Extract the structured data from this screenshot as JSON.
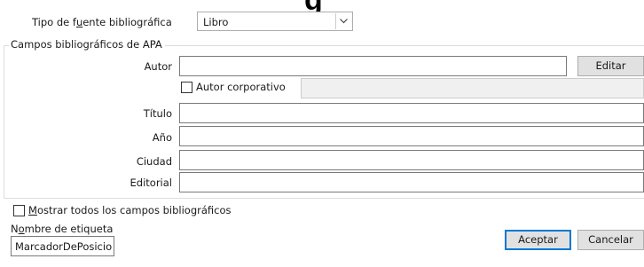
{
  "background_title": {
    "fragment": "g"
  },
  "source_type": {
    "label_pre": "Tipo de f",
    "label_accel": "u",
    "label_post": "ente bibliográfica",
    "selected": "Libro"
  },
  "group": {
    "legend": "Campos bibliográficos de APA"
  },
  "fields": {
    "autor": {
      "label": "Autor",
      "value": ""
    },
    "autor_corporativo": {
      "label": "Autor corporativo",
      "checked": false,
      "value": ""
    },
    "titulo": {
      "label": "Título",
      "value": ""
    },
    "anio": {
      "label": "Año",
      "value": ""
    },
    "ciudad": {
      "label": "Ciudad",
      "value": ""
    },
    "editorial": {
      "label": "Editorial",
      "value": ""
    }
  },
  "buttons": {
    "edit": "Editar",
    "accept": "Aceptar",
    "cancel": "Cancelar"
  },
  "show_all": {
    "accel": "M",
    "rest": "ostrar todos los campos bibliográficos",
    "checked": false
  },
  "tag_name": {
    "label_pre": "N",
    "label_accel": "o",
    "label_post": "mbre de etiqueta",
    "value": "MarcadorDePosicio"
  },
  "colors": {
    "accent": "#0078d7",
    "button_face": "#e1e1e1",
    "disabled_field": "#f0f0f0"
  }
}
